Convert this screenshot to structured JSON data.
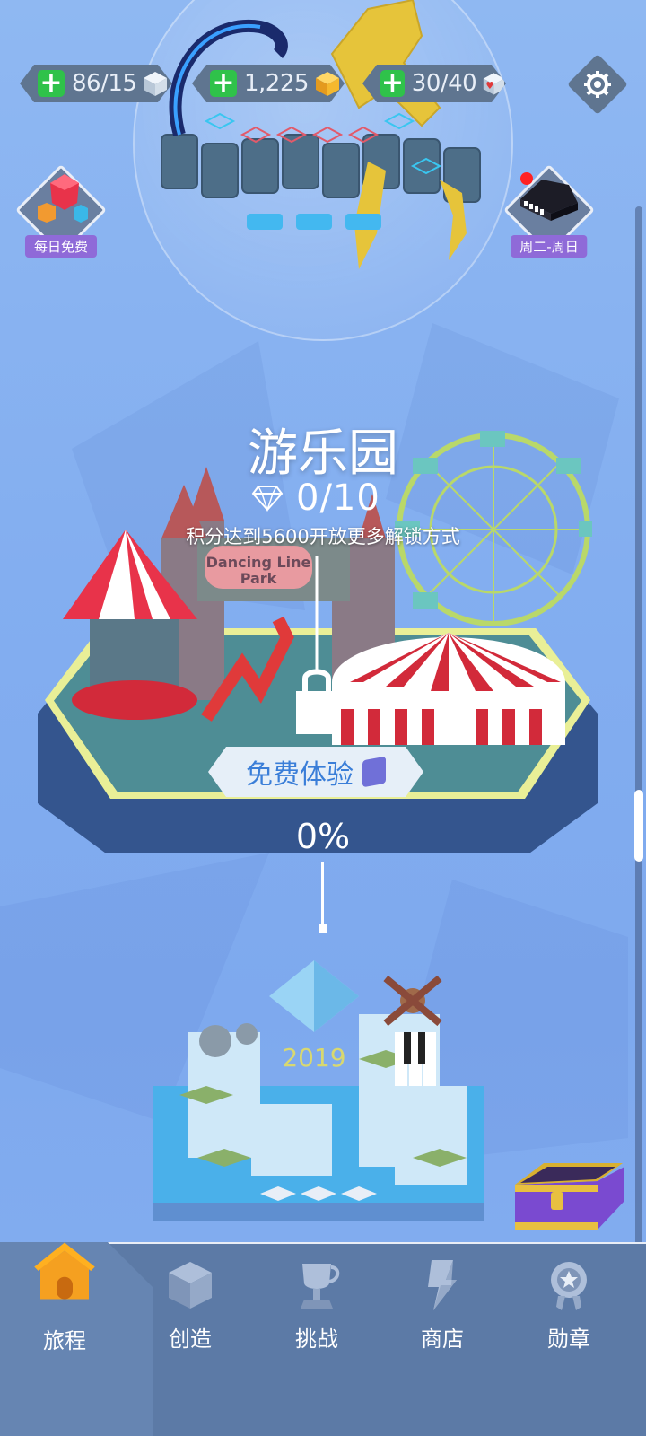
{
  "resources": [
    {
      "value": "86/15",
      "icon": "white-cube-icon",
      "color": "#d8e4f0"
    },
    {
      "value": "1,225",
      "icon": "gold-cube-icon",
      "color": "#f5b82e"
    },
    {
      "value": "30/40",
      "icon": "heart-cube-icon",
      "color": "#e03a3a"
    }
  ],
  "side_buttons": {
    "left_label": "每日免费",
    "right_label": "周二-周日"
  },
  "level": {
    "title": "游乐园",
    "gem_count": "0/10",
    "hint": "积分达到5600开放更多解锁方式",
    "sign_text_line1": "Dancing Line",
    "sign_text_line2": "Park",
    "free_button_label": "免费体验",
    "progress": "0%"
  },
  "next_level": {
    "year": "2019"
  },
  "nav": [
    {
      "label": "旅程",
      "icon": "house-icon",
      "active": true
    },
    {
      "label": "创造",
      "icon": "create-cube-icon",
      "active": false
    },
    {
      "label": "挑战",
      "icon": "trophy-icon",
      "active": false
    },
    {
      "label": "商店",
      "icon": "shop-icon",
      "active": false
    },
    {
      "label": "勋章",
      "icon": "medal-icon",
      "active": false
    }
  ],
  "colors": {
    "accent_green": "#2fc24a",
    "pill_bg": "#5f7590",
    "purple_label": "#8f6ad8",
    "free_btn_text": "#3a7ed8",
    "nav_bg": "#5c7aa6"
  }
}
